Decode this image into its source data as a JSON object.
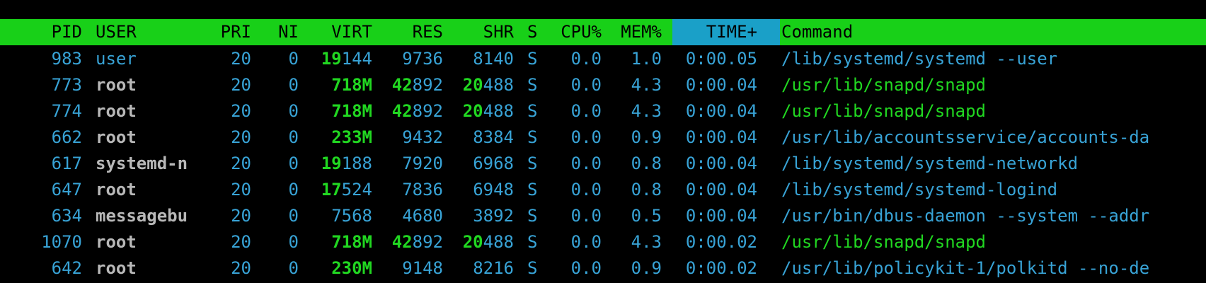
{
  "columns": {
    "pid": "PID",
    "user": "USER",
    "pri": "PRI",
    "ni": "NI",
    "virt": "VIRT",
    "res": "RES",
    "shr": "SHR",
    "s": "S",
    "cpu": "CPU%",
    "mem": "MEM%",
    "time": "TIME+",
    "command": "Command"
  },
  "sorted_column": "TIME+",
  "colors": {
    "header_bg": "#18d018",
    "sort_highlight": "#1aa0c8",
    "cyan": "#38a3d6",
    "green": "#21d721",
    "grey": "#b8b8b8"
  },
  "processes": [
    {
      "pid": "983",
      "user": "user",
      "pri": "20",
      "ni": "0",
      "virt_hi": "19",
      "virt_lo": "144",
      "res_hi": "",
      "res_lo": "9736",
      "shr_hi": "",
      "shr_lo": "8140",
      "s": "S",
      "cpu": "0.0",
      "mem": "1.0",
      "time": "0:00.05",
      "command": "/lib/systemd/systemd --user"
    },
    {
      "pid": "773",
      "user": "root",
      "pri": "20",
      "ni": "0",
      "virt_hi": "718M",
      "virt_lo": "",
      "res_hi": "42",
      "res_lo": "892",
      "shr_hi": "20",
      "shr_lo": "488",
      "s": "S",
      "cpu": "0.0",
      "mem": "4.3",
      "time": "0:00.04",
      "command": "/usr/lib/snapd/snapd"
    },
    {
      "pid": "774",
      "user": "root",
      "pri": "20",
      "ni": "0",
      "virt_hi": "718M",
      "virt_lo": "",
      "res_hi": "42",
      "res_lo": "892",
      "shr_hi": "20",
      "shr_lo": "488",
      "s": "S",
      "cpu": "0.0",
      "mem": "4.3",
      "time": "0:00.04",
      "command": "/usr/lib/snapd/snapd"
    },
    {
      "pid": "662",
      "user": "root",
      "pri": "20",
      "ni": "0",
      "virt_hi": "233M",
      "virt_lo": "",
      "res_hi": "",
      "res_lo": "9432",
      "shr_hi": "",
      "shr_lo": "8384",
      "s": "S",
      "cpu": "0.0",
      "mem": "0.9",
      "time": "0:00.04",
      "command": "/usr/lib/accountsservice/accounts-da"
    },
    {
      "pid": "617",
      "user": "systemd-n",
      "pri": "20",
      "ni": "0",
      "virt_hi": "19",
      "virt_lo": "188",
      "res_hi": "",
      "res_lo": "7920",
      "shr_hi": "",
      "shr_lo": "6968",
      "s": "S",
      "cpu": "0.0",
      "mem": "0.8",
      "time": "0:00.04",
      "command": "/lib/systemd/systemd-networkd"
    },
    {
      "pid": "647",
      "user": "root",
      "pri": "20",
      "ni": "0",
      "virt_hi": "17",
      "virt_lo": "524",
      "res_hi": "",
      "res_lo": "7836",
      "shr_hi": "",
      "shr_lo": "6948",
      "s": "S",
      "cpu": "0.0",
      "mem": "0.8",
      "time": "0:00.04",
      "command": "/lib/systemd/systemd-logind"
    },
    {
      "pid": "634",
      "user": "messagebu",
      "pri": "20",
      "ni": "0",
      "virt_hi": "",
      "virt_lo": "7568",
      "res_hi": "",
      "res_lo": "4680",
      "shr_hi": "",
      "shr_lo": "3892",
      "s": "S",
      "cpu": "0.0",
      "mem": "0.5",
      "time": "0:00.04",
      "command": "/usr/bin/dbus-daemon --system --addr"
    },
    {
      "pid": "1070",
      "user": "root",
      "pri": "20",
      "ni": "0",
      "virt_hi": "718M",
      "virt_lo": "",
      "res_hi": "42",
      "res_lo": "892",
      "shr_hi": "20",
      "shr_lo": "488",
      "s": "S",
      "cpu": "0.0",
      "mem": "4.3",
      "time": "0:00.02",
      "command": "/usr/lib/snapd/snapd"
    },
    {
      "pid": "642",
      "user": "root",
      "pri": "20",
      "ni": "0",
      "virt_hi": "230M",
      "virt_lo": "",
      "res_hi": "",
      "res_lo": "9148",
      "shr_hi": "",
      "shr_lo": "8216",
      "s": "S",
      "cpu": "0.0",
      "mem": "0.9",
      "time": "0:00.02",
      "command": "/usr/lib/policykit-1/polkitd --no-de"
    }
  ]
}
